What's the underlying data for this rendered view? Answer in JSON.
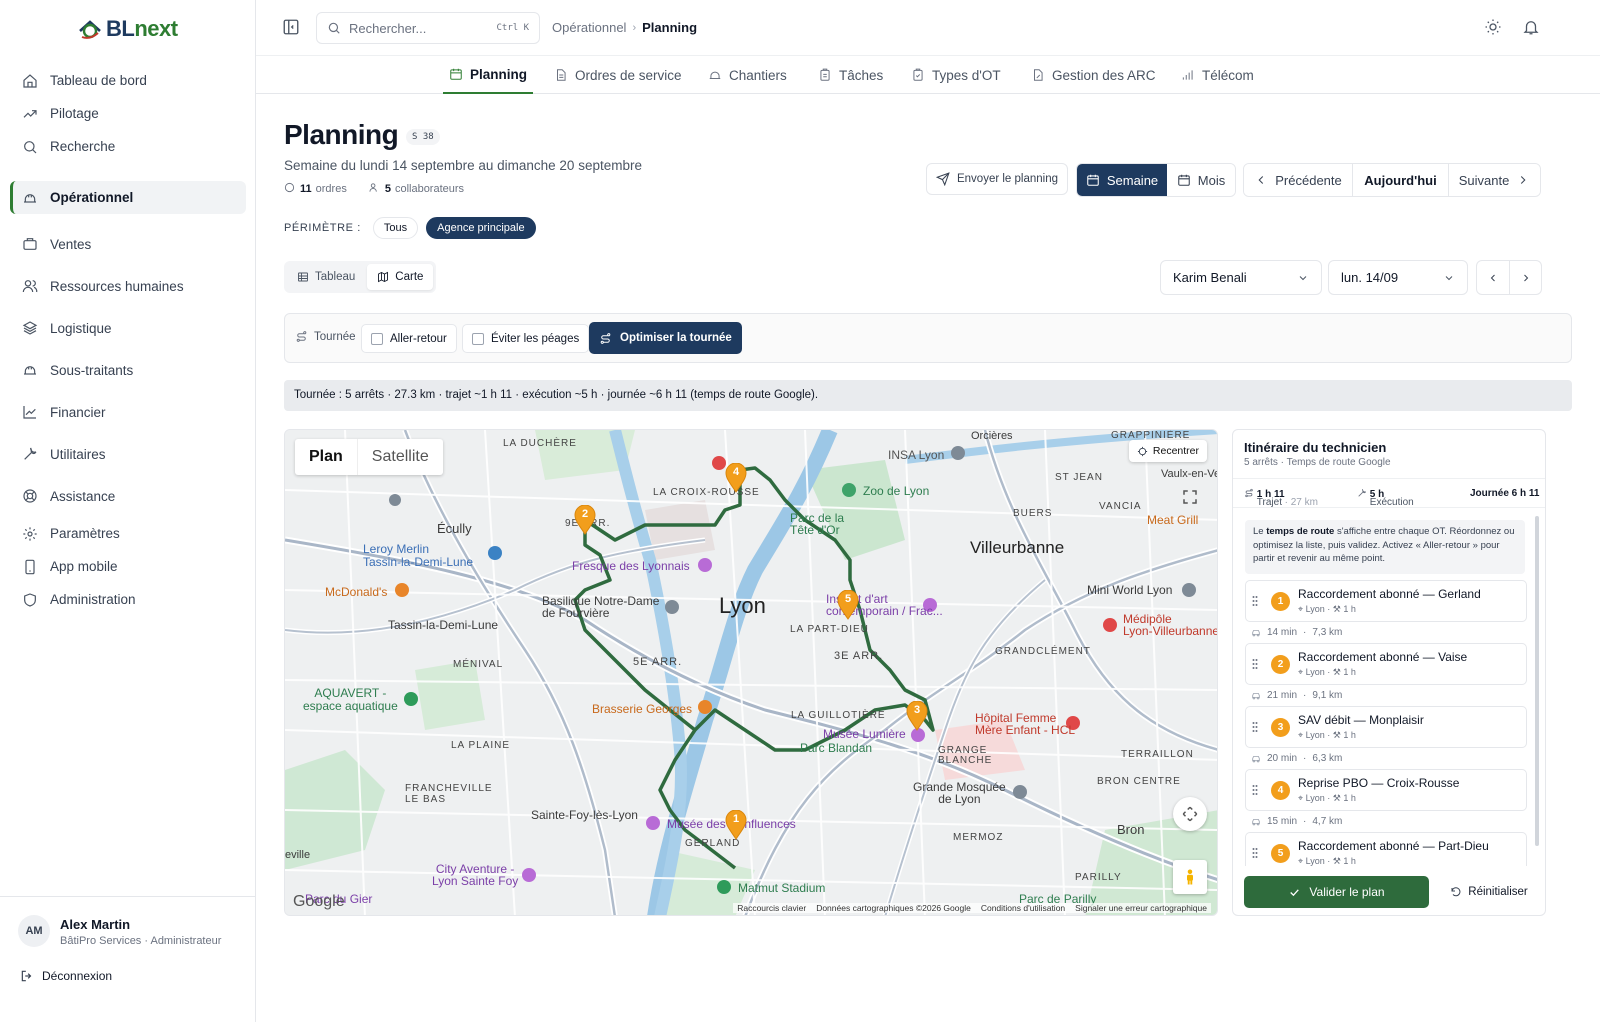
{
  "brand": {
    "name_part1": "BL",
    "name_part2": "next"
  },
  "sidebar": {
    "items": [
      {
        "label": "Tableau de bord",
        "icon": "home-icon"
      },
      {
        "label": "Pilotage",
        "icon": "trend-icon"
      },
      {
        "label": "Recherche",
        "icon": "search-icon"
      },
      {
        "label": "Opérationnel",
        "icon": "helmet-icon",
        "active": true
      },
      {
        "label": "Ventes",
        "icon": "briefcase-icon"
      },
      {
        "label": "Ressources humaines",
        "icon": "users-icon"
      },
      {
        "label": "Logistique",
        "icon": "layers-icon"
      },
      {
        "label": "Sous-traitants",
        "icon": "helmet-icon"
      },
      {
        "label": "Financier",
        "icon": "chart-line-icon"
      },
      {
        "label": "Utilitaires",
        "icon": "wrench-icon"
      },
      {
        "label": "Assistance",
        "icon": "lifebuoy-icon"
      },
      {
        "label": "Paramètres",
        "icon": "gear-icon"
      },
      {
        "label": "App mobile",
        "icon": "phone-icon"
      },
      {
        "label": "Administration",
        "icon": "shield-icon"
      }
    ],
    "user": {
      "initials": "AM",
      "name": "Alex Martin",
      "role": "BâtiPro Services · Administrateur"
    },
    "logout_label": "Déconnexion"
  },
  "topbar": {
    "search_placeholder": "Rechercher...",
    "search_shortcut": "Ctrl K",
    "breadcrumb": [
      "Opérationnel",
      "Planning"
    ]
  },
  "tabs": [
    {
      "label": "Planning",
      "active": true
    },
    {
      "label": "Ordres de service"
    },
    {
      "label": "Chantiers"
    },
    {
      "label": "Tâches"
    },
    {
      "label": "Types d'OT"
    },
    {
      "label": "Gestion des ARC"
    },
    {
      "label": "Télécom"
    }
  ],
  "page": {
    "title": "Planning",
    "week_badge": "S 38",
    "subtitle": "Semaine du lundi 14 septembre au dimanche 20 septembre",
    "orders_count": "11",
    "orders_label": "ordres",
    "collab_count": "5",
    "collab_label": "collaborateurs",
    "perimeter_label": "PÉRIMÈTRE :",
    "perimeter_options": [
      "Tous",
      "Agence principale"
    ],
    "send_planning": "Envoyer le planning",
    "view_week": "Semaine",
    "view_month": "Mois",
    "prev": "Précédente",
    "today": "Aujourd'hui",
    "next": "Suivante",
    "view_table": "Tableau",
    "view_map": "Carte",
    "technician": "Karim Benali",
    "day": "lun. 14/09"
  },
  "tour": {
    "label": "Tournée",
    "round_trip": "Aller-retour",
    "avoid_tolls": "Éviter les péages",
    "optimize": "Optimiser la tournée",
    "summary": "Tournée : 5 arrêts · 27.3 km · trajet ~1 h 11 · exécution ~5 h · journée ~6 h 11 (temps de route Google)."
  },
  "map": {
    "type_plan": "Plan",
    "type_satellite": "Satellite",
    "recenter": "Recentrer",
    "google": "Google",
    "attribution": [
      "Raccourcis clavier",
      "Données cartographiques ©2026 Google",
      "Conditions d'utilisation",
      "Signaler une erreur cartographique"
    ],
    "labels": {
      "lyon": "Lyon",
      "villeurbanne": "Villeurbanne",
      "ecully": "Écully",
      "tassin": "Tassin-la-Demi-Lune",
      "ste_foy": "Sainte-Foy-lès-Lyon",
      "bron": "Bron",
      "vaulx": "Vaulx-en-Veli",
      "la_duchere": "LA DUCHÈRE",
      "croix_rousse": "LA CROIX-ROUSSE",
      "grappiniere": "GRAPPINIÈRE",
      "st_jean": "ST JEAN",
      "buers": "BUERS",
      "vancia": "VANCIA",
      "part_dieu": "LA PART-DIEU",
      "arr3": "3E ARR.",
      "arr5": "5E ARR.",
      "arr9": "9E ARR.",
      "menival": "MÉNIVAL",
      "grandclement": "GRANDCLÉMENT",
      "guillotiere": "LA GUILLOTIÈRE",
      "grange_blanche": "GRANGE\nBLANCHE",
      "terraillon": "TERRAILLON",
      "bron_centre": "BRON CENTRE",
      "la_plaine": "LA PLAINE",
      "francheville": "FRANCHEVILLE\nLE BAS",
      "mermoz": "MERMOZ",
      "parilly": "PARILLY",
      "gerland": "GERLAND",
      "orcieres": "Orcières",
      "eville": "eville",
      "insa": "INSA Lyon",
      "zoo": "Zoo de Lyon",
      "parc_tete_or": "Parc de la\nTête d'Or",
      "meat_grill": "Meat Grill",
      "leroy": "Leroy Merlin\nTassin-la-Demi-Lune",
      "mcdo": "McDonald's",
      "fresque": "Fresque des Lyonnais",
      "fourviere": "Basilique Notre-Dame\nde Fourvière",
      "institut": "Institut d'art\ncontemporain / Frac...",
      "mini_world": "Mini World Lyon",
      "medipole": "Médipôle\nLyon-Villeurbanne",
      "aquavert": "AQUAVERT -\nespace aquatique",
      "brasserie": "Brasserie Georges",
      "musee_lumiere": "Musée Lumière",
      "parc_blandan": "Parc Blandan",
      "hopital": "Hôpital Femme\nMère Enfant - HCL",
      "mosquee": "Grande Mosquée\nde Lyon",
      "confluences": "Musée des Confluences",
      "matmut": "Matmut Stadium",
      "city_aventure": "City Aventure -\nLyon Sainte Foy",
      "parc_parilly": "Parc de Parilly",
      "parc_du_gier": "Parc du Gier"
    },
    "pins": [
      "1",
      "2",
      "3",
      "4",
      "5"
    ]
  },
  "itinerary": {
    "title": "Itinéraire du technicien",
    "subtitle": "5 arrêts · Temps de route Google",
    "travel_label": "Trajet",
    "travel_value": "1 h 11",
    "travel_km": "· 27 km",
    "exec_label": "Exécution",
    "exec_value": "5 h",
    "day_label": "Journée 6 h 11",
    "note_pre": "Le ",
    "note_bold": "temps de route",
    "note_post": " s'affiche entre chaque OT. Réordonnez ou optimisez la liste, puis validez. Activez « Aller-retour » pour partir et revenir au même point.",
    "stops": [
      {
        "n": "1",
        "title": "Raccordement abonné — Gerland",
        "city": "Lyon",
        "dur": "1 h"
      },
      {
        "n": "2",
        "title": "Raccordement abonné — Vaise",
        "city": "Lyon",
        "dur": "1 h"
      },
      {
        "n": "3",
        "title": "SAV débit — Monplaisir",
        "city": "Lyon",
        "dur": "1 h"
      },
      {
        "n": "4",
        "title": "Reprise PBO — Croix-Rousse",
        "city": "Lyon",
        "dur": "1 h"
      },
      {
        "n": "5",
        "title": "Raccordement abonné — Part-Dieu",
        "city": "Lyon",
        "dur": "1 h"
      }
    ],
    "legs": [
      {
        "time": "14 min",
        "dist": "7,3 km"
      },
      {
        "time": "21 min",
        "dist": "9,1 km"
      },
      {
        "time": "20 min",
        "dist": "6,3 km"
      },
      {
        "time": "15 min",
        "dist": "4,7 km"
      }
    ],
    "validate": "Valider le plan",
    "reset": "Réinitialiser"
  },
  "colors": {
    "brand_navy": "#1e3a5f",
    "brand_green": "#2e7d32",
    "route": "#2f6b3f",
    "pin": "#f29e1c"
  }
}
